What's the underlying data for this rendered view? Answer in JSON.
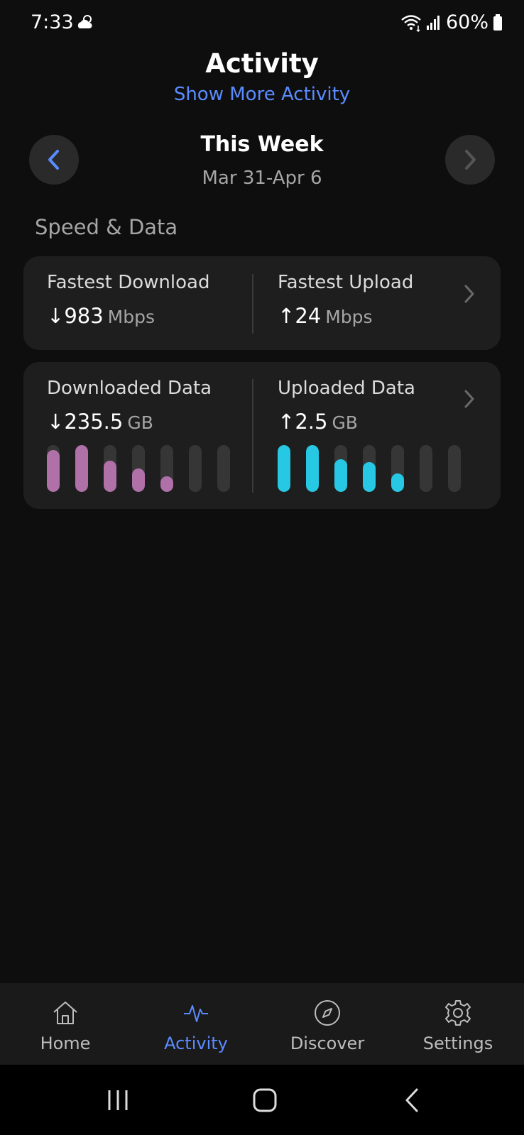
{
  "status_bar": {
    "time": "7:33",
    "battery": "60%"
  },
  "header": {
    "title": "Activity",
    "show_more": "Show More Activity"
  },
  "week": {
    "title": "This Week",
    "range": "Mar 31-Apr 6"
  },
  "section": {
    "title": "Speed & Data"
  },
  "speed_card": {
    "download": {
      "label": "Fastest Download",
      "arrow": "↓",
      "value": "983",
      "unit": "Mbps"
    },
    "upload": {
      "label": "Fastest Upload",
      "arrow": "↑",
      "value": "24",
      "unit": "Mbps"
    }
  },
  "data_card": {
    "downloaded": {
      "label": "Downloaded Data",
      "arrow": "↓",
      "value": "235.5",
      "unit": "GB",
      "daily_levels": [
        0.9,
        1.0,
        0.66,
        0.5,
        0.33,
        0,
        0
      ]
    },
    "uploaded": {
      "label": "Uploaded Data",
      "arrow": "↑",
      "value": "2.5",
      "unit": "GB",
      "daily_levels": [
        1.0,
        1.0,
        0.7,
        0.64,
        0.4,
        0,
        0
      ]
    }
  },
  "colors": {
    "accent": "#5b8cff",
    "download_bar": "#b070a8",
    "upload_bar": "#27c8e3"
  },
  "bottom_nav": {
    "items": [
      {
        "label": "Home",
        "icon": "home-icon",
        "active": false
      },
      {
        "label": "Activity",
        "icon": "activity-icon",
        "active": true
      },
      {
        "label": "Discover",
        "icon": "compass-icon",
        "active": false
      },
      {
        "label": "Settings",
        "icon": "gear-icon",
        "active": false
      }
    ]
  }
}
